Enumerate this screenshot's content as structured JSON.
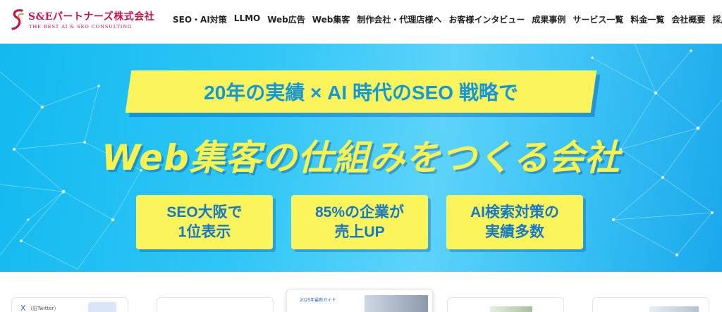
{
  "brand": {
    "name": "S&Eパートナーズ株式会社",
    "tagline": "THE BEST AI & SEO CONSULTING",
    "color": "#c3154a"
  },
  "nav": {
    "items": [
      {
        "label": "SEO・AI対策"
      },
      {
        "label": "LLMO"
      },
      {
        "label": "Web広告"
      },
      {
        "label": "Web集客"
      },
      {
        "label": "制作会社・代理店様へ"
      },
      {
        "label": "お客様インタビュー"
      },
      {
        "label": "成果事例"
      },
      {
        "label": "サービス一覧"
      },
      {
        "label": "料金一覧"
      },
      {
        "label": "会社概要"
      },
      {
        "label": "採用情報"
      }
    ]
  },
  "hero": {
    "tagline": "20年の実績 × AI 時代のSEO 戦略で",
    "headline": "Web集客の仕組みをつくる会社",
    "badges": [
      {
        "line1": "SEO大阪で",
        "line2": "1位表示"
      },
      {
        "line1": "85%の企業が",
        "line2": "売上UP"
      },
      {
        "line1": "AI検索対策の",
        "line2": "実績多数"
      }
    ],
    "colors": {
      "background": "#2fc6f6",
      "highlight": "#fbf45a",
      "tagline_text": "#1497d9",
      "badge_text": "#1678c8"
    }
  },
  "cards": {
    "x_label": "X",
    "x_tag": "（旧Twitter）",
    "guide_label": "2025年最新ガイド"
  }
}
